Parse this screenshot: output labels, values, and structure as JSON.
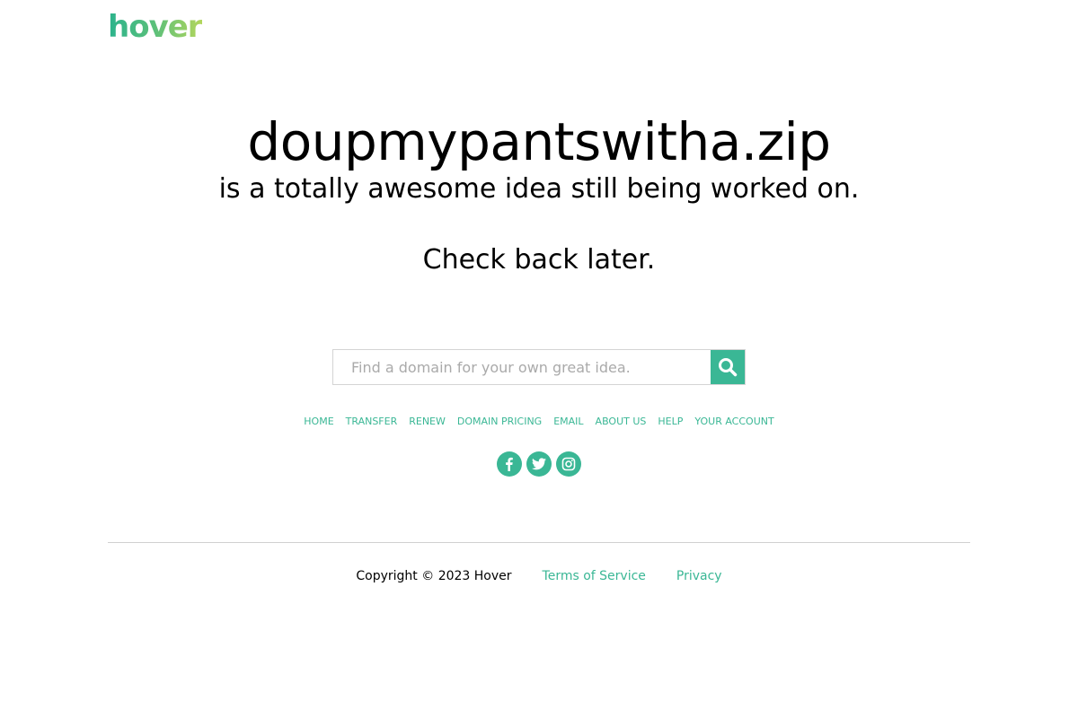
{
  "brand": {
    "logo_text": "hover",
    "accent_color": "#3ab795"
  },
  "main": {
    "domain": "doupmypantswitha.zip",
    "subtitle": "is a totally awesome idea still being worked on.",
    "check_back": "Check back later."
  },
  "search": {
    "placeholder": "Find a domain for your own great idea.",
    "value": "",
    "button_icon": "search-icon"
  },
  "nav": [
    {
      "label": "HOME"
    },
    {
      "label": "TRANSFER"
    },
    {
      "label": "RENEW"
    },
    {
      "label": "DOMAIN PRICING"
    },
    {
      "label": "EMAIL"
    },
    {
      "label": "ABOUT US"
    },
    {
      "label": "HELP"
    },
    {
      "label": "YOUR ACCOUNT"
    }
  ],
  "social": [
    "facebook-icon",
    "twitter-icon",
    "instagram-icon"
  ],
  "footer": {
    "copyright": "Copyright © 2023 Hover",
    "terms": "Terms of Service",
    "privacy": "Privacy"
  }
}
